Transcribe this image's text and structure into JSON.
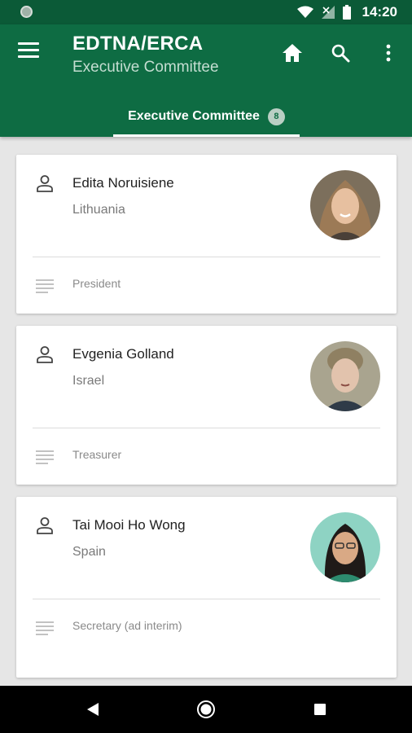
{
  "status_bar": {
    "time": "14:20"
  },
  "app_bar": {
    "title": "EDTNA/ERCA",
    "subtitle": "Executive Committee"
  },
  "tabs": [
    {
      "label": "Executive Committee",
      "badge": "8",
      "selected": true
    }
  ],
  "members": [
    {
      "name": "Edita Noruisiene",
      "country": "Lithuania",
      "role": "President"
    },
    {
      "name": "Evgenia Golland",
      "country": "Israel",
      "role": "Treasurer"
    },
    {
      "name": "Tai Mooi Ho Wong",
      "country": "Spain",
      "role": "Secretary (ad interim)"
    }
  ],
  "colors": {
    "primary": "#0e6c43",
    "status_bar": "#0b5a37",
    "background": "#e6e6e6",
    "card": "#ffffff"
  },
  "icons": {
    "menu": "hamburger-menu-icon",
    "home": "home-icon",
    "search": "search-icon",
    "more": "more-vert-icon",
    "person": "person-outline-icon",
    "notes": "notes-icon"
  }
}
